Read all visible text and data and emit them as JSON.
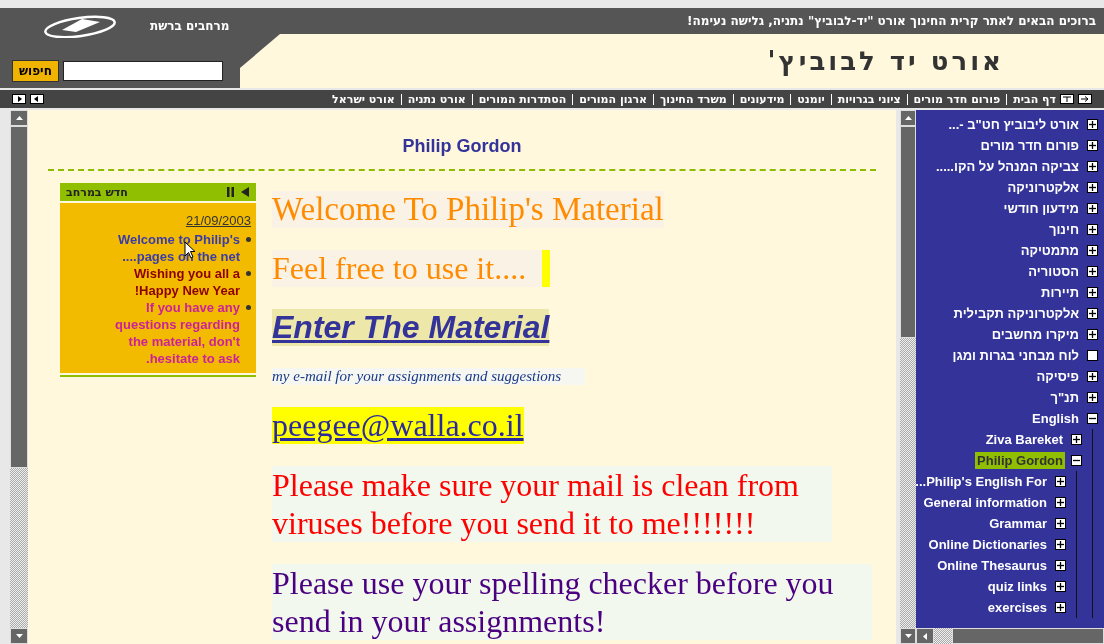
{
  "header": {
    "welcome": "ברוכים הבאים לאתר קרית החינוך אורט \"יד-לבוביץ\" נתניה, גלישה נעימה!",
    "network_label": "מרחבים ברשת",
    "site_title": "אורט יד לבוביץ'",
    "search": {
      "button": "חיפוש"
    }
  },
  "nav": {
    "links": [
      "דף הבית",
      "פורום חדר מורים",
      "ציוני בגרויות",
      "יומנט",
      "מידעונים",
      "משרד החינוך",
      "ארגון המורים",
      "הסתדרות המורים",
      "אורט נתניה",
      "אורט ישראל"
    ]
  },
  "page_title": "Philip Gordon",
  "news": {
    "title": "חדש במרחב",
    "date": "21/09/2003",
    "items": [
      {
        "text": "Welcome to Philip's pages on the net....",
        "color": "#3c3ca8"
      },
      {
        "text": "Wishing you all a Happy New Year!",
        "color": "#8b0000"
      },
      {
        "text": "If you have any questions regarding the material, don't hesitate to ask.",
        "color": "#cc2299"
      }
    ]
  },
  "content": [
    {
      "kind": "heading",
      "text": "Welcome To Philip's Material"
    },
    {
      "kind": "subheading",
      "text": "Feel free to use it...."
    },
    {
      "kind": "link",
      "text": "Enter The Material"
    },
    {
      "kind": "note",
      "text": "my e-mail for your assignments and suggestions"
    },
    {
      "kind": "email",
      "text": "peegee@walla.co.il"
    },
    {
      "kind": "warning",
      "text": "Please make sure your mail is clean from viruses before you send it to me!!!!!!!"
    },
    {
      "kind": "notice",
      "text": "Please use your spelling checker before you send in your assignments!"
    }
  ],
  "sidebar": {
    "items": [
      {
        "label": "אורט ליבוביץ חט\"ב -...",
        "kind": "folder",
        "expanded": false,
        "selected": false
      },
      {
        "label": "פורום חדר מורים",
        "kind": "folder",
        "expanded": false,
        "selected": false
      },
      {
        "label": "צביקה המנהל על הקו.....",
        "kind": "folder",
        "expanded": false,
        "selected": false
      },
      {
        "label": "אלקטרוניקה",
        "kind": "folder",
        "expanded": false,
        "selected": false
      },
      {
        "label": "מידעון חודשי",
        "kind": "folder",
        "expanded": false,
        "selected": false
      },
      {
        "label": "חינוך",
        "kind": "folder",
        "expanded": false,
        "selected": false
      },
      {
        "label": "מתמטיקה",
        "kind": "folder",
        "expanded": false,
        "selected": false
      },
      {
        "label": "הסטוריה",
        "kind": "folder",
        "expanded": false,
        "selected": false
      },
      {
        "label": "תיירות",
        "kind": "folder",
        "expanded": false,
        "selected": false
      },
      {
        "label": "אלקטרוניקה תקבילית",
        "kind": "folder",
        "expanded": false,
        "selected": false
      },
      {
        "label": "מיקרו מחשבים",
        "kind": "folder",
        "expanded": false,
        "selected": false
      },
      {
        "label": "לוח מבחני בגרות ומגן",
        "kind": "leaf",
        "selected": false
      },
      {
        "label": "פיסיקה",
        "kind": "folder",
        "expanded": false,
        "selected": false
      },
      {
        "label": "תנ\"ך",
        "kind": "folder",
        "expanded": false,
        "selected": false
      },
      {
        "label": "English",
        "kind": "folder",
        "expanded": true,
        "selected": false,
        "children": [
          {
            "label": "Ziva Bareket",
            "kind": "folder",
            "expanded": false,
            "selected": false
          },
          {
            "label": "Philip Gordon",
            "kind": "folder",
            "expanded": true,
            "selected": true,
            "children": [
              {
                "label": "Philip's English For...",
                "kind": "folder",
                "expanded": false,
                "selected": false
              },
              {
                "label": "General information",
                "kind": "folder",
                "expanded": false,
                "selected": false
              },
              {
                "label": "Grammar",
                "kind": "folder",
                "expanded": false,
                "selected": false
              },
              {
                "label": "Online Dictionaries",
                "kind": "folder",
                "expanded": false,
                "selected": false
              },
              {
                "label": "Online Thesaurus",
                "kind": "folder",
                "expanded": false,
                "selected": false
              },
              {
                "label": "quiz links",
                "kind": "folder",
                "expanded": false,
                "selected": false
              },
              {
                "label": "exercises",
                "kind": "folder",
                "expanded": false,
                "selected": false
              }
            ]
          }
        ]
      }
    ]
  }
}
